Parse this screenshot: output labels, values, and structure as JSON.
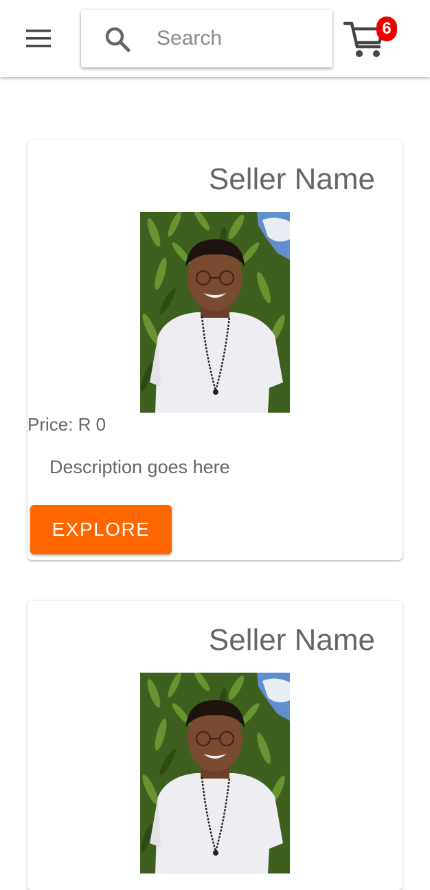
{
  "header": {
    "menu_icon": "hamburger-menu-icon",
    "search": {
      "placeholder": "Search",
      "value": "",
      "icon": "search-icon"
    },
    "cart": {
      "icon": "shopping-cart-icon",
      "count": "6"
    }
  },
  "products": [
    {
      "seller_name": "Seller Name",
      "price_label": "Price: R 0",
      "description": "Description goes here",
      "button_label": "EXPLORE"
    },
    {
      "seller_name": "Seller Name"
    }
  ],
  "colors": {
    "accent": "#ff6600",
    "badge": "#ee0000",
    "text": "#666666"
  }
}
